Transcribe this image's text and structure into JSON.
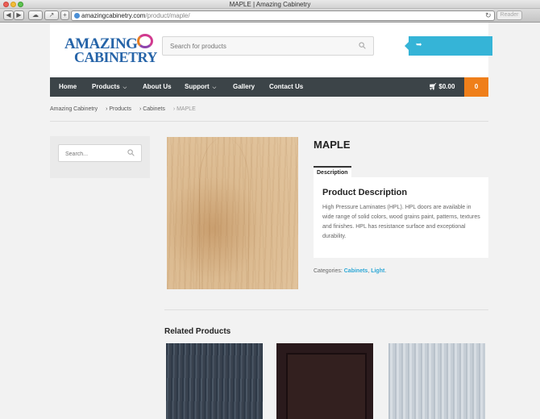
{
  "browser": {
    "window_title": "MAPLE | Amazing Cabinetry",
    "url_host": "amazingcabinetry.com",
    "url_path": "/product/maple/",
    "reader_label": "Reader"
  },
  "header": {
    "logo_line1": "AMAZING",
    "logo_line2": "CABINETRY",
    "search_placeholder": "Search for products"
  },
  "nav": {
    "items": [
      {
        "label": "Home"
      },
      {
        "label": "Products"
      },
      {
        "label": "About Us"
      },
      {
        "label": "Support"
      },
      {
        "label": "Gallery"
      },
      {
        "label": "Contact Us"
      }
    ],
    "cart_total": "$0.00",
    "cart_count": "0"
  },
  "breadcrumb": {
    "items": [
      "Amazing Cabinetry",
      "› Products",
      "› Cabinets",
      "› MAPLE"
    ]
  },
  "sidebar": {
    "search_placeholder": "Search..."
  },
  "product": {
    "title": "MAPLE",
    "tab_label": "Description",
    "description_heading": "Product Description",
    "description_text": "High Pressure Laminates (HPL). HPL doors are available in wide range of solid colors, wood grains paint, patterns, textures and finishes. HPL has resistance surface and exceptional durability.",
    "categories_label": "Categories:",
    "categories": [
      "Cabinets",
      "Light"
    ]
  },
  "related": {
    "title": "Related Products"
  },
  "colors": {
    "nav_bg": "#3c4448",
    "accent_blue": "#35b4d7",
    "accent_orange": "#ef7f1a"
  }
}
